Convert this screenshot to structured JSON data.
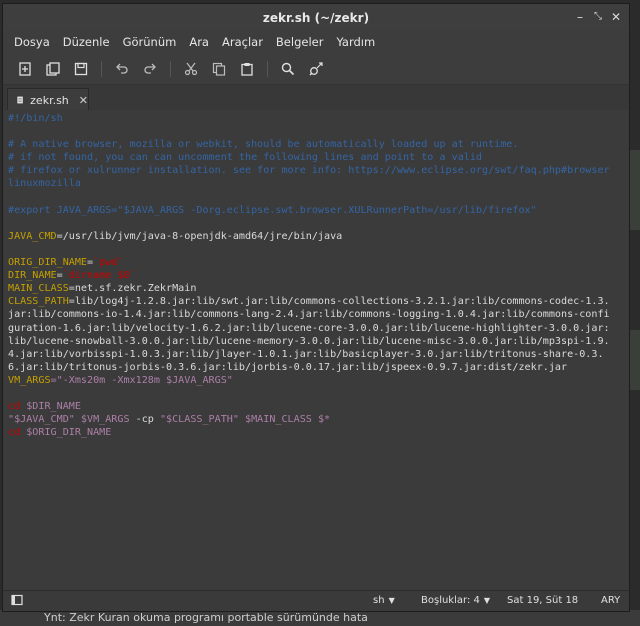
{
  "window": {
    "title": "zekr.sh (~/zekr)"
  },
  "menu": [
    "Dosya",
    "Düzenle",
    "Görünüm",
    "Ara",
    "Araçlar",
    "Belgeler",
    "Yardım"
  ],
  "tab": {
    "label": "zekr.sh"
  },
  "code_lines": [
    [
      {
        "t": "#!/bin/sh",
        "c": "c-com"
      }
    ],
    [
      {
        "t": "",
        "c": "c-norm"
      }
    ],
    [
      {
        "t": "# A native browser, mozilla or webkit, should be automatically loaded up at runtime.",
        "c": "c-com"
      }
    ],
    [
      {
        "t": "# if not found, you can can uncomment the following lines and point to a valid",
        "c": "c-com"
      }
    ],
    [
      {
        "t": "# firefox or xulrunner installation. see for more info: https://www.eclipse.org/swt/faq.php#browserlinuxmozilla",
        "c": "c-com"
      }
    ],
    [
      {
        "t": "",
        "c": "c-norm"
      }
    ],
    [
      {
        "t": "#export JAVA_ARGS=\"$JAVA_ARGS -Dorg.eclipse.swt.browser.XULRunnerPath=/usr/lib/firefox\"",
        "c": "c-com"
      }
    ],
    [
      {
        "t": "",
        "c": "c-norm"
      }
    ],
    [
      {
        "t": "JAVA_CMD",
        "c": "c-var"
      },
      {
        "t": "=/usr/lib/jvm/java-8-openjdk-amd64/jre/bin/java",
        "c": "c-norm"
      }
    ],
    [
      {
        "t": "",
        "c": "c-norm"
      }
    ],
    [
      {
        "t": "ORIG_DIR_NAME",
        "c": "c-var"
      },
      {
        "t": "=",
        "c": "c-norm"
      },
      {
        "t": "`",
        "c": "c-red"
      },
      {
        "t": "pwd",
        "c": "c-red"
      },
      {
        "t": "`",
        "c": "c-red"
      }
    ],
    [
      {
        "t": "DIR_NAME",
        "c": "c-var"
      },
      {
        "t": "=",
        "c": "c-norm"
      },
      {
        "t": "`",
        "c": "c-red"
      },
      {
        "t": "dirname $0",
        "c": "c-red"
      },
      {
        "t": "`",
        "c": "c-red"
      }
    ],
    [
      {
        "t": "MAIN_CLASS",
        "c": "c-var"
      },
      {
        "t": "=net.sf.zekr.ZekrMain",
        "c": "c-norm"
      }
    ],
    [
      {
        "t": "CLASS_PATH",
        "c": "c-var"
      },
      {
        "t": "=lib/log4j-1.2.8.jar:lib/swt.jar:lib/commons-collections-3.2.1.jar:lib/commons-codec-1.3.jar:lib/commons-io-1.4.jar:lib/commons-lang-2.4.jar:lib/commons-logging-1.0.4.jar:lib/commons-configuration-1.6.jar:lib/velocity-1.6.2.jar:lib/lucene-core-3.0.0.jar:lib/lucene-highlighter-3.0.0.jar:lib/lucene-snowball-3.0.0.jar:lib/lucene-memory-3.0.0.jar:lib/lucene-misc-3.0.0.jar:lib/mp3spi-1.9.4.jar:lib/vorbisspi-1.0.3.jar:lib/jlayer-1.0.1.jar:lib/basicplayer-3.0.jar:lib/tritonus-share-0.3.6.jar:lib/tritonus-jorbis-0.3.6.jar:lib/jorbis-0.0.17.jar:lib/jspeex-0.9.7.jar:dist/zekr.jar",
        "c": "c-norm"
      }
    ],
    [
      {
        "t": "VM_ARGS",
        "c": "c-var"
      },
      {
        "t": "=\"-Xms20m -Xmx128m $JAVA_ARGS\"",
        "c": "c-str"
      }
    ],
    [
      {
        "t": "",
        "c": "c-norm"
      }
    ],
    [
      {
        "t": "cd",
        "c": "c-red"
      },
      {
        "t": " $DIR_NAME",
        "c": "c-str"
      }
    ],
    [
      {
        "t": "\"$JAVA_CMD\" $VM_ARGS",
        "c": "c-str"
      },
      {
        "t": " -cp ",
        "c": "c-norm"
      },
      {
        "t": "\"$CLASS_PATH\" $MAIN_CLASS $*",
        "c": "c-str"
      }
    ],
    [
      {
        "t": "cd",
        "c": "c-red"
      },
      {
        "t": " $ORIG_DIR_NAME",
        "c": "c-str"
      }
    ]
  ],
  "status": {
    "language": "sh",
    "tab_width": "Boşluklar: 4",
    "cursor": "Sat 19, Süt 18",
    "mode": "ARY"
  },
  "background_text": "Ynt: Zekr Kuran okuma programı portable sürümünde hata"
}
